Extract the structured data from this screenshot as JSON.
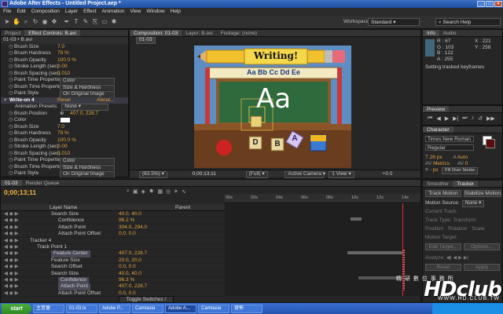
{
  "titlebar": {
    "title": "Adobe After Effects - Untitled Project.aep *"
  },
  "menu": [
    "File",
    "Edit",
    "Composition",
    "Layer",
    "Effect",
    "Animation",
    "View",
    "Window",
    "Help"
  ],
  "toolbar": {
    "workspace_label": "Workspace:",
    "workspace_value": "Standard",
    "search_placeholder": "Search Help"
  },
  "project_panel": {
    "tabs": [
      "Project",
      "Effect Controls: B.avi"
    ],
    "layer_label": "01-03 • B.avi",
    "rows": [
      {
        "ind": 1,
        "name": "Brush Size",
        "val": "7.0"
      },
      {
        "ind": 1,
        "name": "Brush Hardness",
        "val": "79 %"
      },
      {
        "ind": 1,
        "name": "Brush Opacity",
        "val": "100.0 %"
      },
      {
        "ind": 1,
        "name": "Stroke Length (sec)",
        "val": "0.00"
      },
      {
        "ind": 1,
        "name": "Brush Spacing (sec)",
        "val": "0.010"
      },
      {
        "ind": 1,
        "name": "Paint Time Properties",
        "dd": "Color"
      },
      {
        "ind": 1,
        "name": "Brush Time Properties",
        "dd": "Size & Hardness"
      },
      {
        "ind": 1,
        "name": "Paint Style",
        "dd": "On Original Image"
      }
    ],
    "effect_header": {
      "name": "Write-on 4",
      "reset": "Reset",
      "about": "About..."
    },
    "anim_presets_label": "Animation Presets:",
    "anim_presets_value": "None",
    "rows2": [
      {
        "ind": 1,
        "name": "Brush Position",
        "val": "407.0, 228.7"
      },
      {
        "ind": 1,
        "name": "Color",
        "val": ""
      },
      {
        "ind": 1,
        "name": "Brush Size",
        "val": "7.0"
      },
      {
        "ind": 1,
        "name": "Brush Hardness",
        "val": "79 %"
      },
      {
        "ind": 1,
        "name": "Brush Opacity",
        "val": "100.0 %"
      },
      {
        "ind": 1,
        "name": "Stroke Length (sec)",
        "val": "0.00"
      },
      {
        "ind": 1,
        "name": "Brush Spacing (sec)",
        "val": "0.010"
      },
      {
        "ind": 1,
        "name": "Paint Time Properties",
        "dd": "Color"
      },
      {
        "ind": 1,
        "name": "Brush Time Properties",
        "dd": "Size & Hardness"
      },
      {
        "ind": 1,
        "name": "Paint Style",
        "dd": "On Original Image"
      }
    ]
  },
  "comp_panel": {
    "tabs": [
      "Composition: 01-03",
      "Layer: B.avi",
      "Footage: (none)"
    ],
    "comp_label": "01-03",
    "image": {
      "banner": "Writing!",
      "alphabet": "Aa Bb Cc Dd Ee",
      "big_letters": "Aa",
      "blocks": [
        "D",
        "B",
        "A"
      ]
    },
    "bottom": {
      "zoom": "(63.5%)",
      "time": "0;00;13;11",
      "res": "(Full)",
      "camera": "Active Camera",
      "view": "1 View",
      "plus": "+0.0"
    }
  },
  "info_panel": {
    "tabs": [
      "Info",
      "Audio"
    ],
    "r": "R : 67",
    "g": "G : 103",
    "b": "B : 122",
    "a": "A : 255",
    "x": "X : 221",
    "y": "Y : 258",
    "status": "Setting tracked keyframes"
  },
  "preview_panel": {
    "tab": "Preview"
  },
  "character_panel": {
    "tab": "Character",
    "font": "Times New Roman",
    "style": "Regular",
    "size": "26 px",
    "leading": "Auto",
    "kerning": "Metrics",
    "tracking": "0",
    "stroke_w": "- px",
    "stroke_mode": "Fill Over Stroke",
    "vscale": "100 %",
    "hscale": "100 %",
    "baseline": "0 px",
    "tsume": "0 %"
  },
  "tracker_panel": {
    "tabs": [
      "Smoother",
      "Tracker"
    ],
    "track_motion": "Track Motion",
    "stabilize": "Stabilize Motion",
    "motion_source_label": "Motion Source:",
    "motion_source": "None",
    "current_track_label": "Current Track:",
    "track_type_label": "Track Type:",
    "track_type": "Transform",
    "position": "Position",
    "rotation": "Rotation",
    "scale": "Scale",
    "motion_target": "Motion Target:",
    "edit_target": "Edit Target...",
    "options": "Options...",
    "analyze": "Analyze:",
    "reset": "Reset",
    "apply": "Apply"
  },
  "timeline": {
    "tabs": [
      "01-03",
      "Render Queue"
    ],
    "time": "0;00;13;11",
    "col_layer": "Layer Name",
    "col_parent": "Parent",
    "ruler": [
      "00s",
      "02s",
      "04s",
      "06s",
      "08s",
      "10s",
      "12s",
      "14s"
    ],
    "rows": [
      {
        "ind": 6,
        "name": "Search Size",
        "val": "40.0, 40.0"
      },
      {
        "ind": 7,
        "name": "Confidence",
        "val": "96.2 %"
      },
      {
        "ind": 7,
        "name": "Attach Point",
        "val": "304.0, 294.0"
      },
      {
        "ind": 7,
        "name": "Attach Point Offset",
        "val": "0.0, 0.0"
      },
      {
        "ind": 3,
        "name": "Tracker 4",
        "val": ""
      },
      {
        "ind": 4,
        "name": "Track Point 1",
        "val": ""
      },
      {
        "ind": 6,
        "name": "Feature Center",
        "val": "407.0, 228.7",
        "sel": true
      },
      {
        "ind": 6,
        "name": "Feature Size",
        "val": "20.0, 20.0"
      },
      {
        "ind": 6,
        "name": "Search Offset",
        "val": "0.0, 0.0"
      },
      {
        "ind": 6,
        "name": "Search Size",
        "val": "40.0, 40.0"
      },
      {
        "ind": 7,
        "name": "Confidence",
        "val": "96.3 %",
        "sel": true
      },
      {
        "ind": 7,
        "name": "Attach Point",
        "val": "407.0, 228.7",
        "sel": true
      },
      {
        "ind": 7,
        "name": "Attach Point Offset",
        "val": "0.0, 0.0"
      }
    ],
    "toggle": "Toggle Switches / Modes"
  },
  "taskbar": {
    "start": "start",
    "items": [
      "主音量",
      "01-03.tx",
      "Adobe P...",
      "Camtasia",
      "Adobe A...",
      "Camtasia",
      "發佈"
    ]
  },
  "watermark": {
    "logo": "HDclub",
    "sub": "精 研 數 位 事 務 所",
    "url": "WWW.HD.CLUB.TW"
  }
}
